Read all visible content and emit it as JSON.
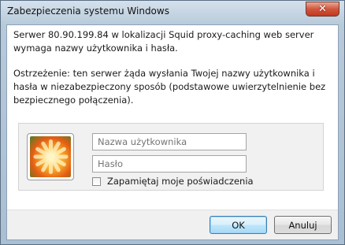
{
  "window": {
    "title": "Zabezpieczenia systemu Windows",
    "close_glyph": "✕"
  },
  "message": {
    "line1": "Serwer 80.90.199.84 w lokalizacji Squid proxy-caching web server wymaga nazwy użytkownika i hasła.",
    "line2": "Ostrzeżenie: ten serwer żąda wysłania Twojej nazwy użytkownika i hasła w niezabezpieczony sposób (podstawowe uwierzytelnienie bez bezpiecznego połączenia)."
  },
  "credentials": {
    "avatar_icon": "user-tile-flower-icon",
    "username": {
      "value": "",
      "placeholder": "Nazwa użytkownika"
    },
    "password": {
      "value": "",
      "placeholder": "Hasło"
    },
    "remember_label": "Zapamiętaj moje poświadczenia",
    "remember_checked": false
  },
  "buttons": {
    "ok": "OK",
    "cancel": "Anuluj"
  },
  "colors": {
    "accent": "#3c7fb1",
    "close": "#c2391f"
  }
}
